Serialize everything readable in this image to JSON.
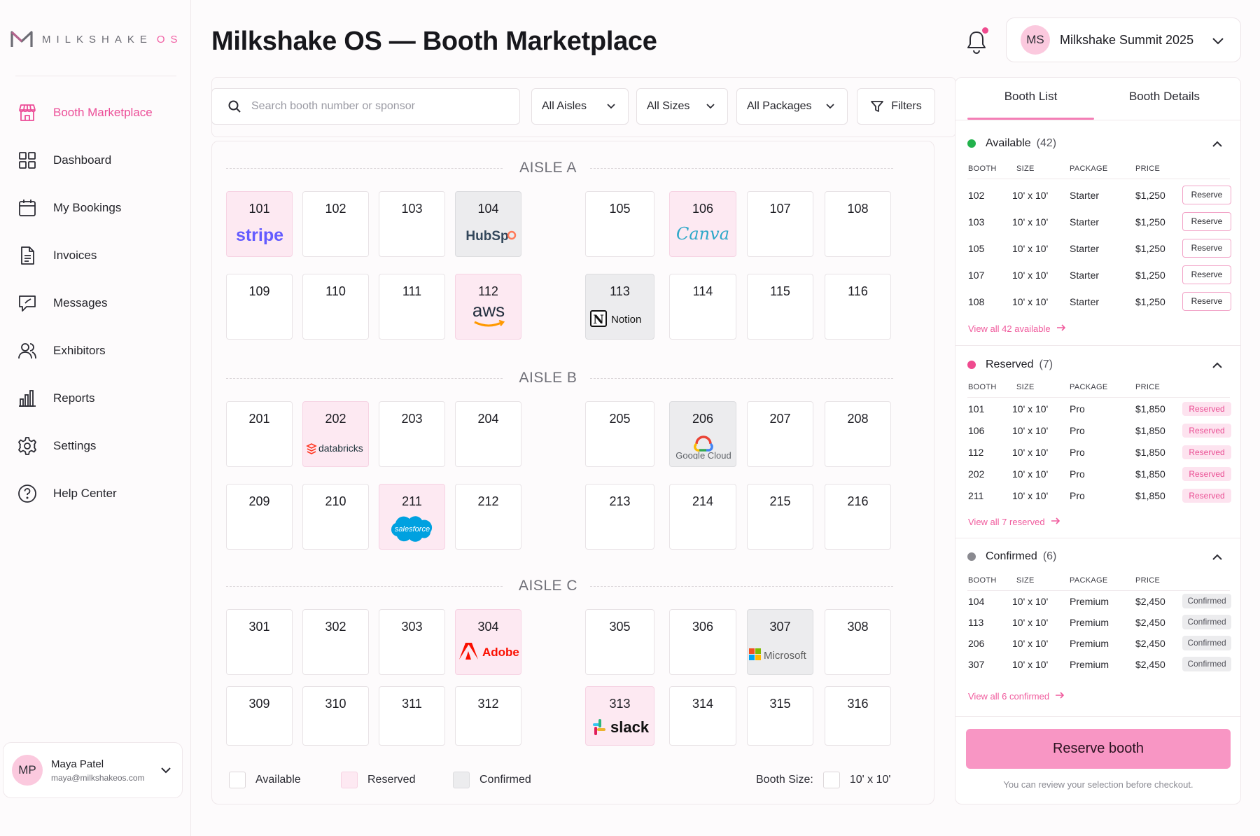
{
  "app": {
    "logo_word": "MILKSHAKE",
    "logo_suffix": "OS",
    "page_title": "Milkshake OS — Booth Marketplace"
  },
  "sidebar": {
    "items": [
      {
        "label": "Booth Marketplace",
        "icon": "storefront-icon",
        "active": true
      },
      {
        "label": "Dashboard",
        "icon": "grid-icon"
      },
      {
        "label": "My Bookings",
        "icon": "calendar-icon"
      },
      {
        "label": "Invoices",
        "icon": "document-icon"
      },
      {
        "label": "Messages",
        "icon": "chat-icon"
      },
      {
        "label": "Exhibitors",
        "icon": "users-icon"
      },
      {
        "label": "Reports",
        "icon": "bar-chart-icon"
      },
      {
        "label": "Settings",
        "icon": "gear-icon"
      },
      {
        "label": "Help Center",
        "icon": "help-icon"
      }
    ],
    "user": {
      "initials": "MP",
      "name": "Maya Patel",
      "email": "maya@milkshakeos.com"
    }
  },
  "header": {
    "event_initials": "MS",
    "event_name": "Milkshake Summit 2025"
  },
  "filters": {
    "search_placeholder": "Search booth number or sponsor",
    "aisles": "All Aisles",
    "sizes": "All Sizes",
    "packages": "All Packages",
    "filters_label": "Filters"
  },
  "map": {
    "aisles": [
      {
        "label": "AISLE A",
        "rows": [
          [
            {
              "n": "101",
              "s": "reserved",
              "b": "stripe"
            },
            {
              "n": "102"
            },
            {
              "n": "103"
            },
            {
              "n": "104",
              "s": "confirmed",
              "b": "HubSpot"
            },
            {
              "n": "105"
            },
            {
              "n": "106",
              "s": "reserved",
              "b": "Canva"
            },
            {
              "n": "107"
            },
            {
              "n": "108"
            }
          ],
          [
            {
              "n": "109"
            },
            {
              "n": "110"
            },
            {
              "n": "111"
            },
            {
              "n": "112",
              "s": "reserved",
              "b": "aws"
            },
            {
              "n": "113",
              "s": "confirmed",
              "b": "Notion"
            },
            {
              "n": "114"
            },
            {
              "n": "115"
            },
            {
              "n": "116"
            }
          ]
        ]
      },
      {
        "label": "AISLE B",
        "rows": [
          [
            {
              "n": "201"
            },
            {
              "n": "202",
              "s": "reserved",
              "b": "databricks"
            },
            {
              "n": "203"
            },
            {
              "n": "204"
            },
            {
              "n": "205"
            },
            {
              "n": "206",
              "s": "confirmed",
              "b": "Google Cloud"
            },
            {
              "n": "207"
            },
            {
              "n": "208"
            }
          ],
          [
            {
              "n": "209"
            },
            {
              "n": "210"
            },
            {
              "n": "211",
              "s": "reserved",
              "b": "salesforce"
            },
            {
              "n": "212"
            },
            {
              "n": "213"
            },
            {
              "n": "214"
            },
            {
              "n": "215"
            },
            {
              "n": "216"
            }
          ]
        ]
      },
      {
        "label": "AISLE C",
        "rows": [
          [
            {
              "n": "301"
            },
            {
              "n": "302"
            },
            {
              "n": "303"
            },
            {
              "n": "304",
              "s": "reserved",
              "b": "Adobe"
            },
            {
              "n": "305"
            },
            {
              "n": "306"
            },
            {
              "n": "307",
              "s": "confirmed",
              "b": "Microsoft"
            },
            {
              "n": "308"
            }
          ],
          [
            {
              "n": "309"
            },
            {
              "n": "310"
            },
            {
              "n": "311"
            },
            {
              "n": "312"
            },
            {
              "n": "313",
              "s": "reserved",
              "b": "slack"
            },
            {
              "n": "314"
            },
            {
              "n": "315"
            },
            {
              "n": "316"
            }
          ]
        ]
      }
    ],
    "legend": {
      "available": "Available",
      "reserved": "Reserved",
      "confirmed": "Confirmed",
      "booth_size_label": "Booth Size:",
      "booth_size_value": "10' x 10'"
    }
  },
  "panel": {
    "tabs": [
      "Booth List",
      "Booth Details"
    ],
    "columns": {
      "booth": "BOOTH",
      "size": "SIZE",
      "package": "PACKAGE",
      "price": "PRICE"
    },
    "available": {
      "title": "Available",
      "count": "(42)",
      "color": "#22b24c",
      "rows": [
        {
          "booth": "102",
          "size": "10' x 10'",
          "package": "Starter",
          "price": "$1,250",
          "action": "Reserve"
        },
        {
          "booth": "103",
          "size": "10' x 10'",
          "package": "Starter",
          "price": "$1,250",
          "action": "Reserve"
        },
        {
          "booth": "105",
          "size": "10' x 10'",
          "package": "Starter",
          "price": "$1,250",
          "action": "Reserve"
        },
        {
          "booth": "107",
          "size": "10' x 10'",
          "package": "Starter",
          "price": "$1,250",
          "action": "Reserve"
        },
        {
          "booth": "108",
          "size": "10' x 10'",
          "package": "Starter",
          "price": "$1,250",
          "action": "Reserve"
        }
      ],
      "view_all": "View all 42 available"
    },
    "reserved": {
      "title": "Reserved",
      "count": "(7)",
      "color": "#ef4b8f",
      "rows": [
        {
          "booth": "101",
          "size": "10' x 10'",
          "package": "Pro",
          "price": "$1,850",
          "action": "Reserved"
        },
        {
          "booth": "106",
          "size": "10' x 10'",
          "package": "Pro",
          "price": "$1,850",
          "action": "Reserved"
        },
        {
          "booth": "112",
          "size": "10' x 10'",
          "package": "Pro",
          "price": "$1,850",
          "action": "Reserved"
        },
        {
          "booth": "202",
          "size": "10' x 10'",
          "package": "Pro",
          "price": "$1,850",
          "action": "Reserved"
        },
        {
          "booth": "211",
          "size": "10' x 10'",
          "package": "Pro",
          "price": "$1,850",
          "action": "Reserved"
        }
      ],
      "view_all": "View all 7 reserved"
    },
    "confirmed": {
      "title": "Confirmed",
      "count": "(6)",
      "color": "#8a8a90",
      "rows": [
        {
          "booth": "104",
          "size": "10' x 10'",
          "package": "Premium",
          "price": "$2,450",
          "action": "Confirmed"
        },
        {
          "booth": "113",
          "size": "10' x 10'",
          "package": "Premium",
          "price": "$2,450",
          "action": "Confirmed"
        },
        {
          "booth": "206",
          "size": "10' x 10'",
          "package": "Premium",
          "price": "$2,450",
          "action": "Confirmed"
        },
        {
          "booth": "307",
          "size": "10' x 10'",
          "package": "Premium",
          "price": "$2,450",
          "action": "Confirmed"
        }
      ],
      "view_all": "View all 6 confirmed"
    },
    "reserve_button": "Reserve booth",
    "footnote": "You can review your selection before checkout."
  }
}
